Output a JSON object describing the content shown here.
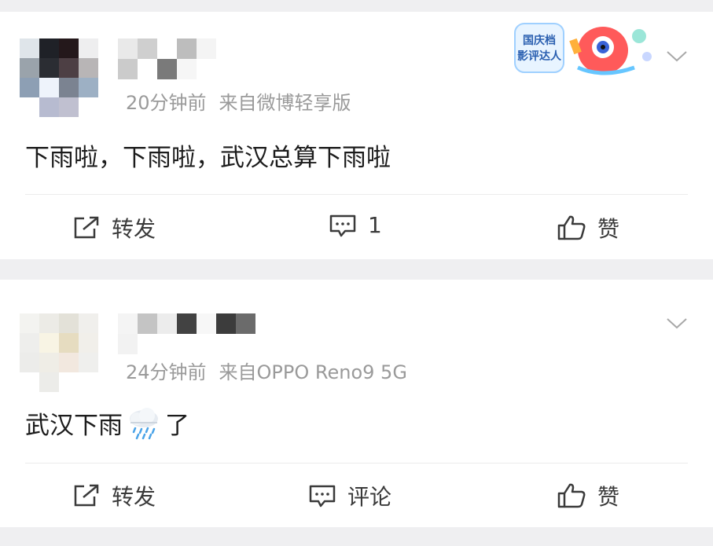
{
  "posts": [
    {
      "time": "20分钟前",
      "source": "来自微博轻享版",
      "content": "下雨啦，下雨啦，武汉总算下雨啦",
      "badge_text": "国庆档影评达人",
      "actions": {
        "repost": "转发",
        "comment": "1",
        "like": "赞"
      },
      "icons": {
        "repost": "share-icon",
        "comment": "comment-icon",
        "like": "thumbs-up-icon",
        "more": "chevron-down-icon"
      }
    },
    {
      "time": "24分钟前",
      "source": "来自OPPO Reno9 5G",
      "content_before": "武汉下雨",
      "content_emoji": "rain-cloud-emoji",
      "content_after": "了",
      "actions": {
        "repost": "转发",
        "comment": "评论",
        "like": "赞"
      },
      "icons": {
        "repost": "share-icon",
        "comment": "comment-icon",
        "like": "thumbs-up-icon",
        "more": "chevron-down-icon"
      }
    }
  ],
  "colors": {
    "background": "#efeff1",
    "card": "#ffffff",
    "meta_text": "#9a9a9a",
    "content_text": "#1c1c1c",
    "action_text": "#3a3a3a"
  }
}
